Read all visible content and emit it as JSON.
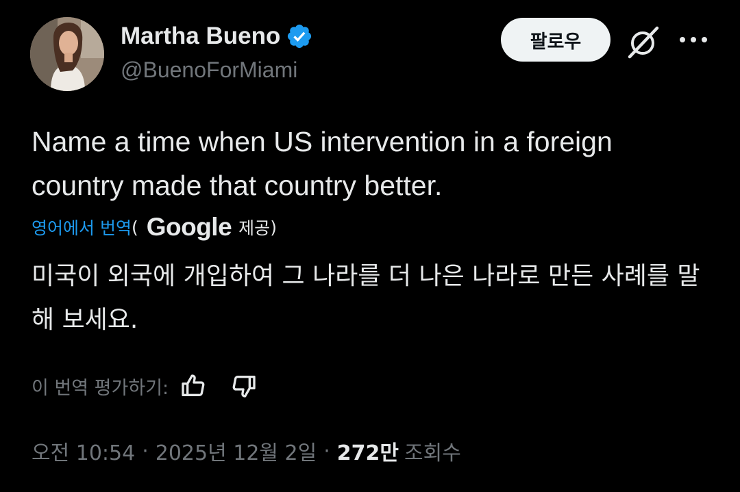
{
  "author": {
    "name": "Martha Bueno",
    "handle": "@BuenoForMiami",
    "verified": true
  },
  "header": {
    "follow_label": "팔로우"
  },
  "tweet": {
    "text": "Name a time when US intervention in a foreign country made that country better."
  },
  "translation": {
    "link_label": "영어에서 번역",
    "paren_open": "(",
    "provider": "Google",
    "provided_label": "제공",
    "paren_close": ")",
    "text": "미국이 외국에 개입하여 그 나라를 더 나은 나라로 만든 사례를 말해 보세요.",
    "rate_label": "이 번역 평가하기:"
  },
  "meta": {
    "time": "오전 10:54",
    "separator": "·",
    "date": "2025년 12월 2일",
    "views_count": "272만",
    "views_label": "조회수"
  },
  "icons": {
    "verified": "verified-badge-icon",
    "grok": "grok-icon",
    "more": "more-icon",
    "thumbs_up": "thumbs-up-icon",
    "thumbs_down": "thumbs-down-icon"
  },
  "colors": {
    "background": "#000000",
    "text": "#e7e9ea",
    "muted": "#71767b",
    "accent": "#1d9bf0",
    "follow_bg": "#eff3f4"
  }
}
